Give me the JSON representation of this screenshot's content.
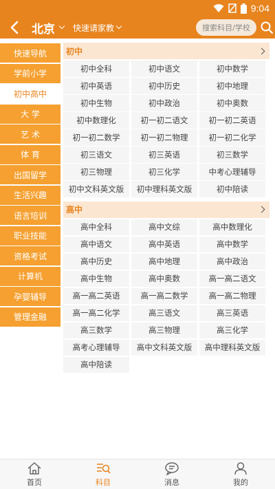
{
  "status": {
    "time": "9:04"
  },
  "header": {
    "city": "北京",
    "quick_menu": "快速请家教",
    "search_placeholder": "搜索科目/学校"
  },
  "sidebar": {
    "items": [
      {
        "label": "快速导航"
      },
      {
        "label": "学前小学"
      },
      {
        "label": "初中高中",
        "active": true
      },
      {
        "label": "大 学"
      },
      {
        "label": "艺 术"
      },
      {
        "label": "体 育"
      },
      {
        "label": "出国留学"
      },
      {
        "label": "生活兴趣"
      },
      {
        "label": "语言培训"
      },
      {
        "label": "职业技能"
      },
      {
        "label": "资格考试"
      },
      {
        "label": "计算机"
      },
      {
        "label": "孕婴辅导"
      },
      {
        "label": "管理金融"
      }
    ]
  },
  "sections": [
    {
      "title": "初中",
      "subjects": [
        "初中全科",
        "初中语文",
        "初中数学",
        "初中英语",
        "初中历史",
        "初中地理",
        "初中生物",
        "初中政治",
        "初中奥数",
        "初中数理化",
        "初一初二语文",
        "初一初二英语",
        "初一初二数学",
        "初一初二物理",
        "初一初二化学",
        "初三语文",
        "初三英语",
        "初三数学",
        "初三物理",
        "初三化学",
        "中考心理辅导",
        "初中文科英文版",
        "初中理科英文版",
        "初中陪读"
      ]
    },
    {
      "title": "高中",
      "subjects": [
        "高中全科",
        "高中文综",
        "高中数理化",
        "高中语文",
        "高中英语",
        "高中数学",
        "高中历史",
        "高中地理",
        "高中政治",
        "高中生物",
        "高中奥数",
        "高一高二语文",
        "高一高二英语",
        "高一高二数学",
        "高一高二物理",
        "高一高二化学",
        "高三语文",
        "高三英语",
        "高三数学",
        "高三物理",
        "高三化学",
        "高考心理辅导",
        "高中文科英文版",
        "高中理科英文版",
        "高中陪读"
      ]
    }
  ],
  "tabs": [
    {
      "label": "首页",
      "icon": "home-icon"
    },
    {
      "label": "科目",
      "icon": "subject-icon",
      "active": true
    },
    {
      "label": "消息",
      "icon": "message-icon"
    },
    {
      "label": "我的",
      "icon": "profile-icon"
    }
  ],
  "colors": {
    "accent": "#e8841e",
    "sidebar": "#f5a030",
    "section_bg": "#fbe6d2"
  }
}
